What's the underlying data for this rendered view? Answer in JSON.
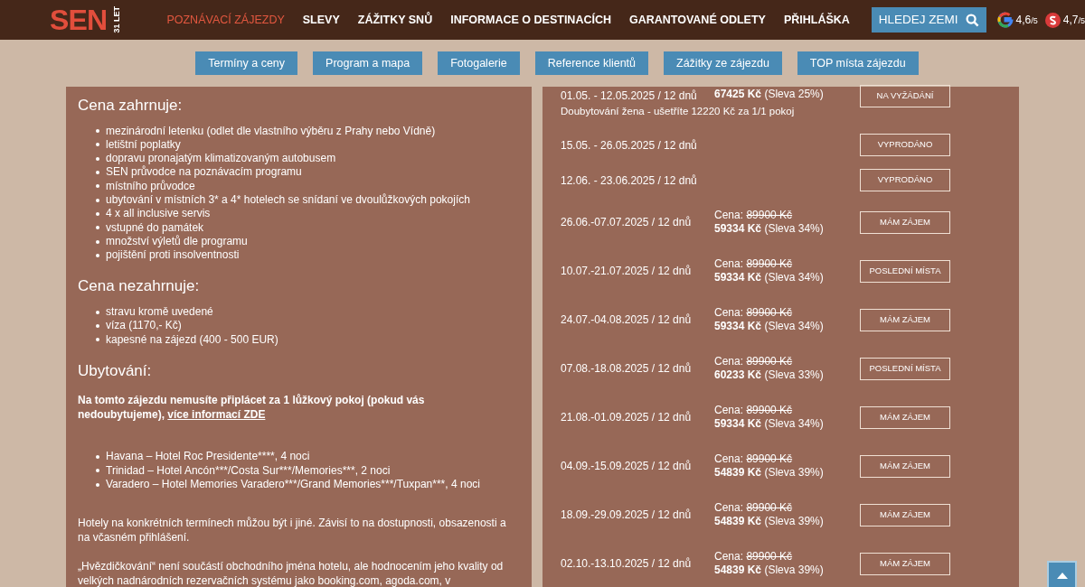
{
  "header": {
    "logo": "SEN",
    "logo_sub": "31 LET",
    "nav": [
      {
        "label": "POZNÁVACÍ ZÁJEZDY",
        "selected": true
      },
      {
        "label": "SLEVY",
        "selected": false
      },
      {
        "label": "ZÁŽITKY SNŮ",
        "selected": false
      },
      {
        "label": "INFORMACE O DESTINACÍCH",
        "selected": false
      },
      {
        "label": "GARANTOVANÉ ODLETY",
        "selected": false
      },
      {
        "label": "PŘIHLÁŠKA",
        "selected": false
      }
    ],
    "search_button": "HLEDEJ ZEMI",
    "ratings": [
      {
        "kind": "google",
        "value": "4,6",
        "unit": "/5"
      },
      {
        "kind": "sen",
        "value": "4,7",
        "unit": "/5"
      }
    ]
  },
  "tabs": [
    "Termíny a ceny",
    "Program a mapa",
    "Fotogalerie",
    "Reference klientů",
    "Zážitky ze zájezdu",
    "TOP místa zájezdu"
  ],
  "included": {
    "title": "Cena zahrnuje:",
    "items": [
      "mezinárodní letenku (odlet dle vlastního výběru z Prahy nebo Vídně)",
      "letištní poplatky",
      "dopravu pronajatým klimatizovaným autobusem",
      "SEN průvodce na poznávacím programu",
      "místního průvodce",
      "ubytování v místních 3* a 4* hotelech se snídaní ve dvoulůžkových pokojích",
      "4 x all inclusive servis",
      "vstupné do památek",
      "množství výletů dle programu",
      "pojištění proti insolventnosti"
    ]
  },
  "excluded": {
    "title": "Cena nezahrnuje:",
    "items": [
      "stravu kromě uvedené",
      "víza (1170,- Kč)",
      "kapesné na zájezd (400 - 500 EUR)"
    ]
  },
  "accommodation": {
    "title": "Ubytování:",
    "note": "Na tomto zájezdu nemusíte připlácet za 1 lůžkový pokoj (pokud vás nedoubytujeme),",
    "link": "více informací ZDE",
    "hotels": [
      "Havana – Hotel Roc Presidente****, 4 noci",
      "Trinidad – Hotel Ancón***/Costa Sur***/Memories***, 2 noci",
      "Varadero – Hotel Memories Varadero***/Grand Memories***/Tuxpan***, 4 noci"
    ],
    "paragraphs": [
      "Hotely na konkrétních termínech můžou být i jiné. Závisí to na dostupnosti, obsazenosti a na včasném přihlášení.",
      "„Hvězdičkování“ není součástí obchodního jména hotelu, ale hodnocením jeho kvality od velkých nadnárodních rezervačních systému jako booking.com, agoda.com, v"
    ]
  },
  "terms": [
    {
      "dates": "01.05. - 12.05.2025 / 12 dnů",
      "price": "**67425 Kč** (Sleva 25%)",
      "note": "Doubytování žena - ušetříte 12220 Kč za 1/1 pokoj",
      "status": "NA VYŽÁDÁNÍ"
    },
    {
      "dates": "15.05. - 26.05.2025 / 12 dnů",
      "status": "VYPRODÁNO"
    },
    {
      "dates": "12.06. - 23.06.2025 / 12 dnů",
      "status": "VYPRODÁNO"
    },
    {
      "dates": "26.06.-07.07.2025 / 12 dnů",
      "label": "Cena:",
      "old_price": "89900 Kč",
      "price": "**59334 Kč** (Sleva 34%)",
      "status": "MÁM ZÁJEM"
    },
    {
      "dates": "10.07.-21.07.2025 / 12 dnů",
      "label": "Cena:",
      "old_price": "89900 Kč",
      "price": "**59334 Kč** (Sleva 34%)",
      "status": "POSLEDNÍ MÍSTA"
    },
    {
      "dates": "24.07.-04.08.2025 / 12 dnů",
      "label": "Cena:",
      "old_price": "89900 Kč",
      "price": "**59334 Kč** (Sleva 34%)",
      "status": "MÁM ZÁJEM"
    },
    {
      "dates": "07.08.-18.08.2025 / 12 dnů",
      "label": "Cena:",
      "old_price": "89900 Kč",
      "price": "**60233 Kč** (Sleva 33%)",
      "status": "POSLEDNÍ MÍSTA"
    },
    {
      "dates": "21.08.-01.09.2025 / 12 dnů",
      "label": "Cena:",
      "old_price": "89900 Kč",
      "price": "**59334 Kč** (Sleva 34%)",
      "status": "MÁM ZÁJEM"
    },
    {
      "dates": "04.09.-15.09.2025 / 12 dnů",
      "label": "Cena:",
      "old_price": "89900 Kč",
      "price": "**54839 Kč** (Sleva 39%)",
      "status": "MÁM ZÁJEM"
    },
    {
      "dates": "18.09.-29.09.2025 / 12 dnů",
      "label": "Cena:",
      "old_price": "89900 Kč",
      "price": "**54839 Kč** (Sleva 39%)",
      "status": "MÁM ZÁJEM"
    },
    {
      "dates": "02.10.-13.10.2025 / 12 dnů",
      "label": "Cena:",
      "old_price": "89900 Kč",
      "price": "**54839 Kč** (Sleva 39%)",
      "status": "MÁM ZÁJEM"
    }
  ]
}
